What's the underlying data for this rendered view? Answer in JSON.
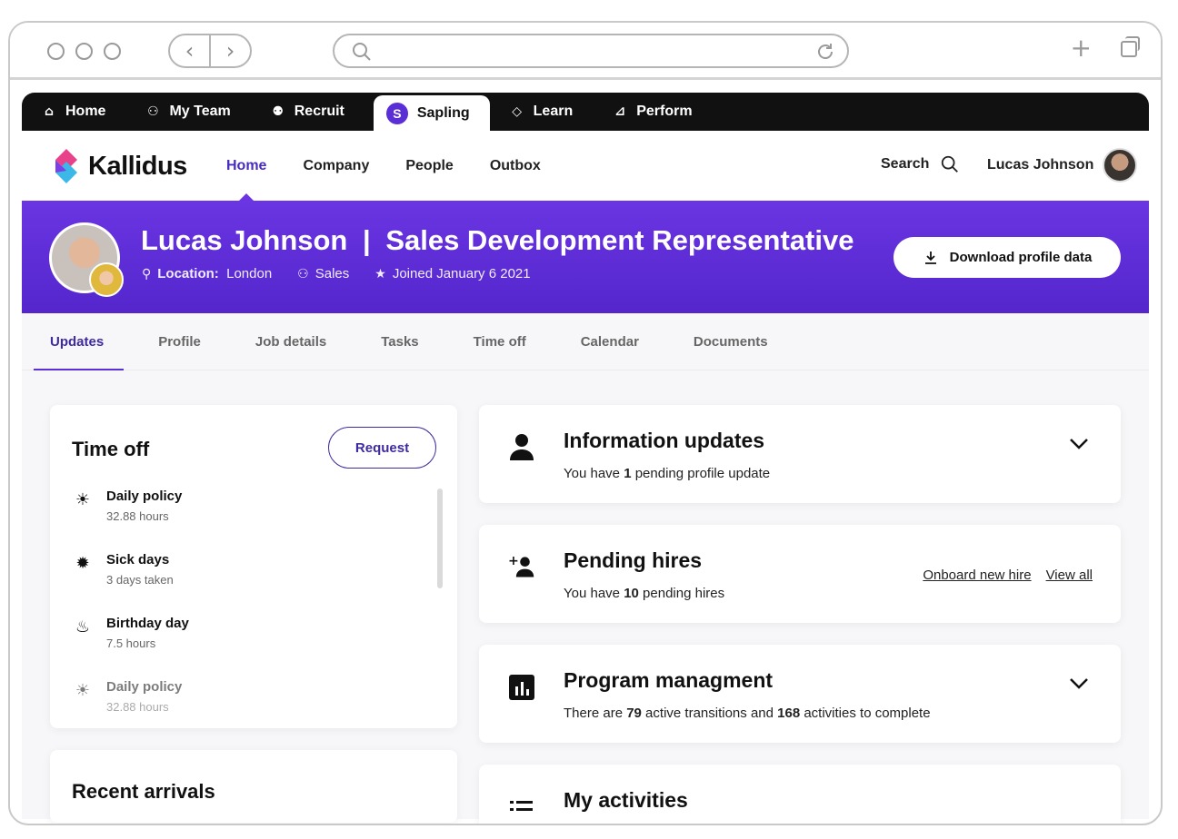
{
  "app_tabs": [
    {
      "label": "Home",
      "icon": "home-icon"
    },
    {
      "label": "My Team",
      "icon": "org-chart-icon"
    },
    {
      "label": "Recruit",
      "icon": "recruit-icon"
    },
    {
      "label": "Sapling",
      "icon": "sapling-logo-icon"
    },
    {
      "label": "Learn",
      "icon": "graduation-cap-icon"
    },
    {
      "label": "Perform",
      "icon": "chart-icon"
    }
  ],
  "brand": {
    "name": "Kallidus"
  },
  "main_nav": [
    "Home",
    "Company",
    "People",
    "Outbox"
  ],
  "search_label": "Search",
  "user_name": "Lucas Johnson",
  "profile": {
    "name": "Lucas Johnson",
    "separator": "|",
    "role": "Sales Development Representative",
    "location_label": "Location:",
    "location": "London",
    "department": "Sales",
    "joined": "Joined January 6 2021",
    "download_label": "Download profile data"
  },
  "sub_tabs": [
    "Updates",
    "Profile",
    "Job details",
    "Tasks",
    "Time off",
    "Calendar",
    "Documents"
  ],
  "time_off": {
    "title": "Time off",
    "request_label": "Request",
    "policies": [
      {
        "name": "Daily policy",
        "detail": "32.88 hours",
        "icon": "sun-icon"
      },
      {
        "name": "Sick days",
        "detail": "3 days taken",
        "icon": "virus-icon"
      },
      {
        "name": "Birthday day",
        "detail": "7.5 hours",
        "icon": "cake-icon"
      },
      {
        "name": "Daily policy",
        "detail": "32.88 hours",
        "icon": "sun-icon"
      }
    ]
  },
  "recent_arrivals": {
    "title": "Recent arrivals"
  },
  "info_updates": {
    "title": "Information updates",
    "text_pre": "You have ",
    "count": "1",
    "text_post": " pending profile update"
  },
  "pending_hires": {
    "title": "Pending hires",
    "text_pre": "You have ",
    "count": "10",
    "text_post": " pending hires",
    "onboard_label": "Onboard new hire",
    "view_all_label": "View all"
  },
  "program": {
    "title": "Program managment",
    "text_pre": "There are ",
    "count1": "79",
    "text_mid": " active transitions and ",
    "count2": "168",
    "text_post": " activities to complete"
  },
  "activities": {
    "title": "My activities"
  },
  "colors": {
    "brand_purple": "#5b2fd6",
    "dark_bar": "#111111"
  }
}
